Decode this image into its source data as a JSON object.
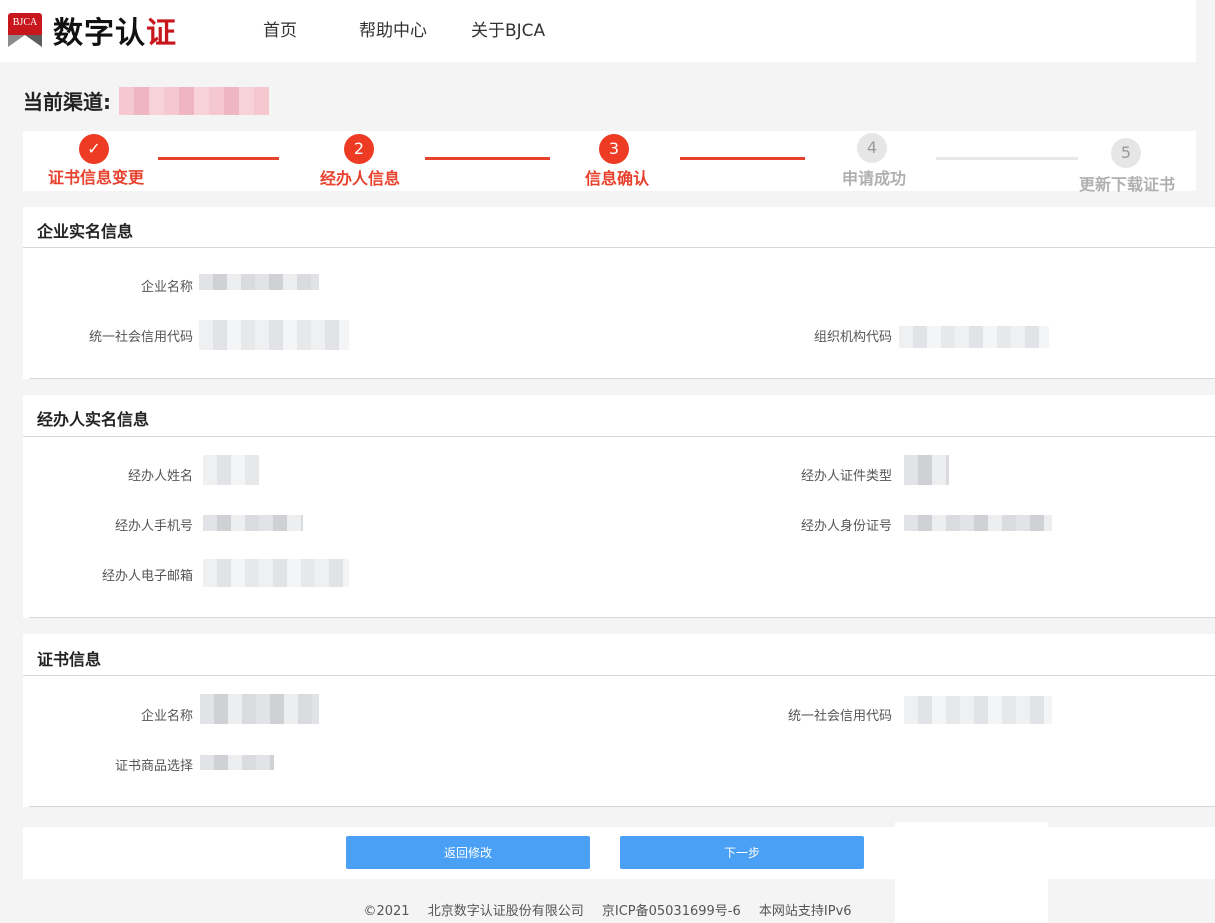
{
  "header": {
    "logo_badge": "BJCA",
    "logo_text_main": "数字认",
    "logo_text_tick": "证",
    "nav": [
      "首页",
      "帮助中心",
      "关于BJCA"
    ]
  },
  "channel": {
    "label": "当前渠道:"
  },
  "steps": [
    {
      "index": "✓",
      "label": "证书信息变更",
      "status": "done"
    },
    {
      "index": "2",
      "label": "经办人信息",
      "status": "done"
    },
    {
      "index": "3",
      "label": "信息确认",
      "status": "current"
    },
    {
      "index": "4",
      "label": "申请成功",
      "status": "todo"
    },
    {
      "index": "5",
      "label": "更新下载证书",
      "status": "todo"
    }
  ],
  "enterprise": {
    "title": "企业实名信息",
    "labels": {
      "name": "企业名称",
      "credit_code": "统一社会信用代码",
      "org_code": "组织机构代码"
    }
  },
  "agent": {
    "title": "经办人实名信息",
    "labels": {
      "name": "经办人姓名",
      "id_type": "经办人证件类型",
      "phone": "经办人手机号",
      "id_number": "经办人身份证号",
      "email": "经办人电子邮箱"
    }
  },
  "certificate": {
    "title": "证书信息",
    "labels": {
      "name": "企业名称",
      "credit_code": "统一社会信用代码",
      "product": "证书商品选择"
    }
  },
  "actions": {
    "back": "返回修改",
    "next": "下一步"
  },
  "footer": [
    "©2021",
    "北京数字认证股份有限公司",
    "京ICP备05031699号-6",
    "本网站支持IPv6"
  ],
  "colors": {
    "accent_red": "#e8412e",
    "button_blue": "#4aa0f5",
    "logo_red": "#c8161d"
  }
}
